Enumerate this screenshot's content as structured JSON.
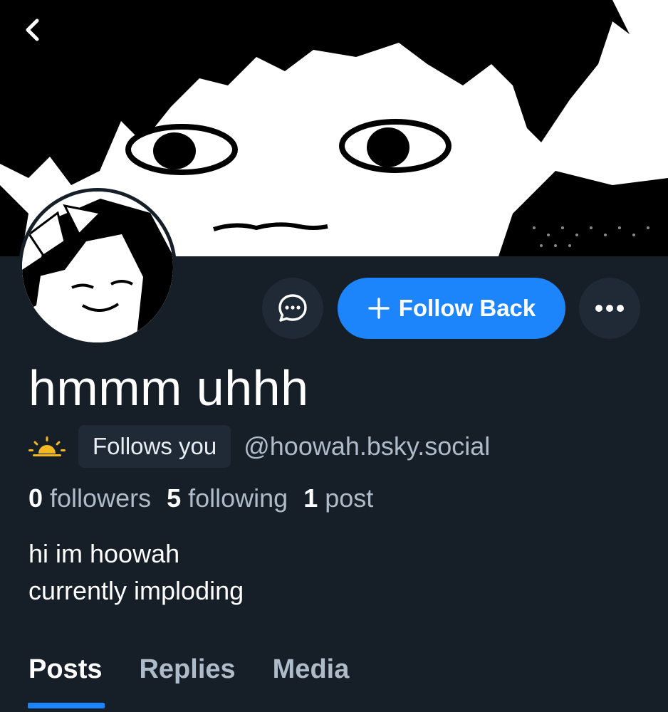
{
  "profile": {
    "display_name": "hmmm uhhh",
    "handle": "@hoowah.bsky.social",
    "follows_you_label": "Follows you",
    "bio_lines": [
      "hi im hoowah",
      "currently imploding"
    ]
  },
  "actions": {
    "follow_back_label": "Follow Back"
  },
  "stats": {
    "followers_count": "0",
    "followers_label": "followers",
    "following_count": "5",
    "following_label": "following",
    "posts_count": "1",
    "posts_label": "post"
  },
  "tabs": [
    {
      "label": "Posts",
      "active": true
    },
    {
      "label": "Replies",
      "active": false
    },
    {
      "label": "Media",
      "active": false
    }
  ],
  "icons": {
    "back": "chevron-left-icon",
    "message": "chat-bubble-icon",
    "follow": "plus-icon",
    "more": "ellipsis-icon",
    "status": "sunrise-icon"
  },
  "colors": {
    "background": "#161e27",
    "accent": "#1d85fc",
    "muted_text": "#aebbc9",
    "surface": "#1f2a36",
    "status_icon": "#f5b91f"
  }
}
